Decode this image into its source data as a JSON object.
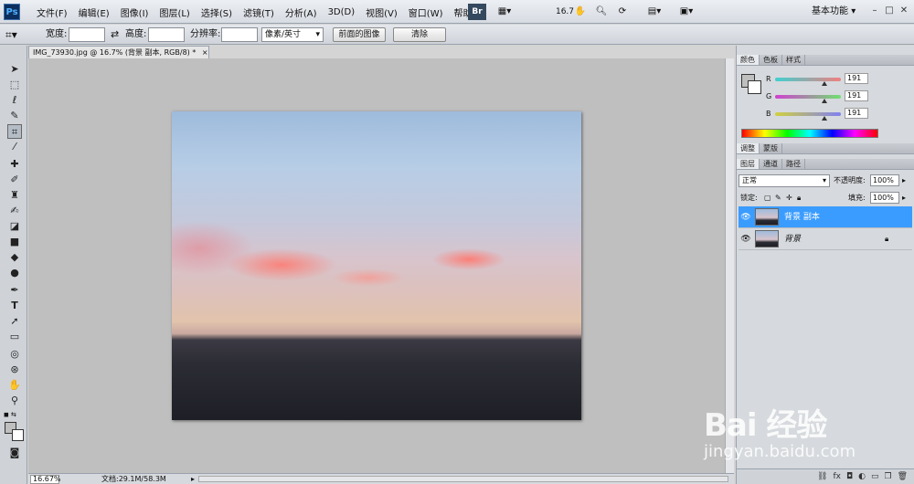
{
  "app": {
    "logo": "Ps",
    "menus": [
      "文件(F)",
      "编辑(E)",
      "图像(I)",
      "图层(L)",
      "选择(S)",
      "滤镜(T)",
      "分析(A)",
      "3D(D)",
      "视图(V)",
      "窗口(W)",
      "帮助(H)"
    ],
    "bridge_label": "Br",
    "zoom_value": "16.7",
    "workspace": "基本功能",
    "window_controls": [
      "–",
      "□",
      "✕"
    ]
  },
  "options": {
    "width_label": "宽度:",
    "height_label": "高度:",
    "resolution_label": "分辨率:",
    "unit_select": "像素/英寸",
    "front_image_button": "前面的图像",
    "clear_button": "清除"
  },
  "tools": [
    "move-icon",
    "marquee-icon",
    "lasso-icon",
    "quick-select-icon",
    "crop-icon",
    "eyedropper-icon",
    "healing-icon",
    "brush-icon",
    "stamp-icon",
    "history-brush-icon",
    "eraser-icon",
    "gradient-icon",
    "blur-icon",
    "dodge-icon",
    "pen-icon",
    "type-icon",
    "path-select-icon",
    "shape-icon",
    "3d-rotate-icon",
    "3d-orbit-icon",
    "hand-icon",
    "zoom-icon"
  ],
  "document": {
    "tab_title": "IMG_73930.jpg @ 16.7% (背景 副本, RGB/8) *",
    "zoom_field": "16.67%",
    "doc_info": "文档:29.1M/58.3M"
  },
  "color_panel": {
    "tabs": [
      "颜色",
      "色板",
      "样式"
    ],
    "channels": [
      {
        "label": "R",
        "value": "191",
        "level": 0.75
      },
      {
        "label": "G",
        "value": "191",
        "level": 0.75
      },
      {
        "label": "B",
        "value": "191",
        "level": 0.75
      }
    ]
  },
  "adjust_panel": {
    "tabs": [
      "调整",
      "蒙版"
    ]
  },
  "layers_panel": {
    "tabs": [
      "图层",
      "通道",
      "路径"
    ],
    "blend_mode": "正常",
    "opacity_label": "不透明度:",
    "opacity_value": "100%",
    "lock_label": "锁定:",
    "fill_label": "填充:",
    "fill_value": "100%",
    "layers": [
      {
        "name": "背景 副本",
        "selected": true
      },
      {
        "name": "背景",
        "selected": false
      }
    ],
    "footer_icons": [
      "link-icon",
      "fx-icon",
      "mask-icon",
      "adjustment-icon",
      "group-icon",
      "new-layer-icon",
      "trash-icon"
    ]
  },
  "watermark": {
    "brand": "Bai 经验",
    "url": "jingyan.baidu.com"
  }
}
